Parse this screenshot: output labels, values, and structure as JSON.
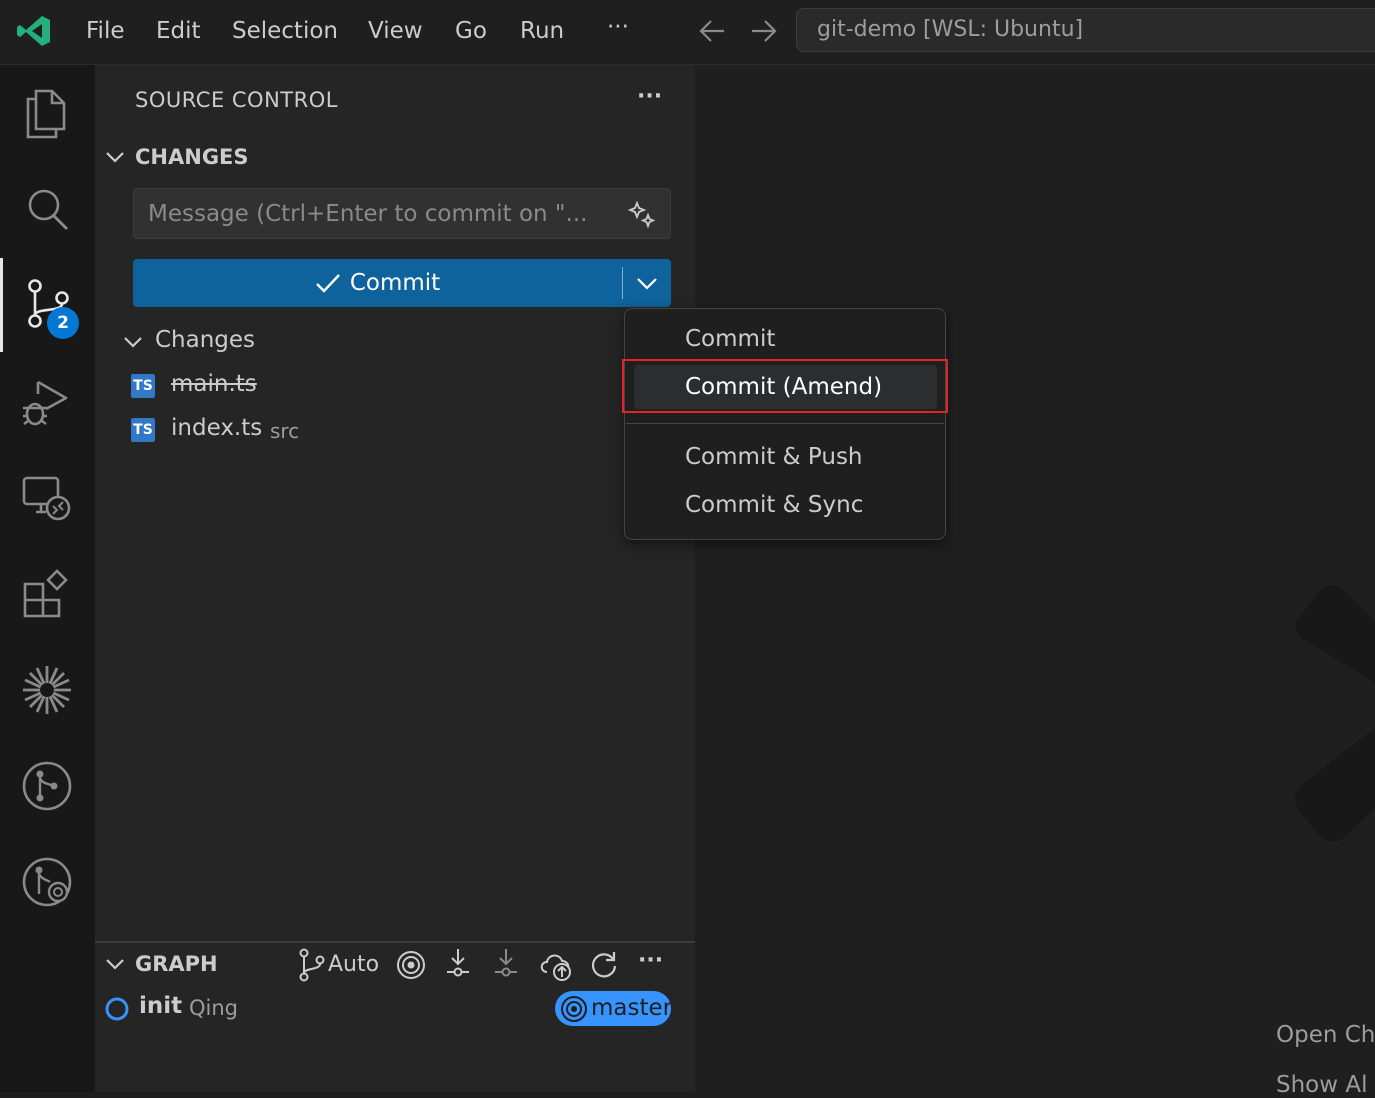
{
  "titlebar": {
    "menu": [
      "File",
      "Edit",
      "Selection",
      "View",
      "Go",
      "Run",
      "···"
    ],
    "command_center": "git-demo [WSL: Ubuntu]"
  },
  "activity": {
    "icons": [
      "explorer-icon",
      "search-icon",
      "source-control-icon",
      "run-debug-icon",
      "remote-explorer-icon",
      "extensions-icon",
      "copilot-icon",
      "git-graph-icon",
      "git-history-icon"
    ],
    "scm_badge": "2"
  },
  "sidebar": {
    "title": "SOURCE CONTROL",
    "more": "···",
    "changes_section": "CHANGES",
    "message_placeholder": "Message (Ctrl+Enter to commit on \"...",
    "commit_label": "Commit",
    "changes_group": "Changes",
    "files": [
      {
        "icon": "TS",
        "name": "main.ts",
        "desc": "",
        "deleted": true
      },
      {
        "icon": "TS",
        "name": "index.ts",
        "desc": "src",
        "deleted": false
      }
    ]
  },
  "graph": {
    "title": "GRAPH",
    "auto_label": "Auto",
    "more": "···",
    "commit_message": "init",
    "commit_author": "Qing",
    "branch": "master"
  },
  "dropdown": {
    "items": [
      "Commit",
      "Commit (Amend)",
      "Commit & Push",
      "Commit & Sync"
    ]
  },
  "editor": {
    "hint1": "Open Ch",
    "hint2": "Show Al"
  },
  "colors": {
    "accent": "#0e639c",
    "badge": "#0078d4",
    "branch": "#3794ff",
    "highlight_box": "#e0242b"
  }
}
